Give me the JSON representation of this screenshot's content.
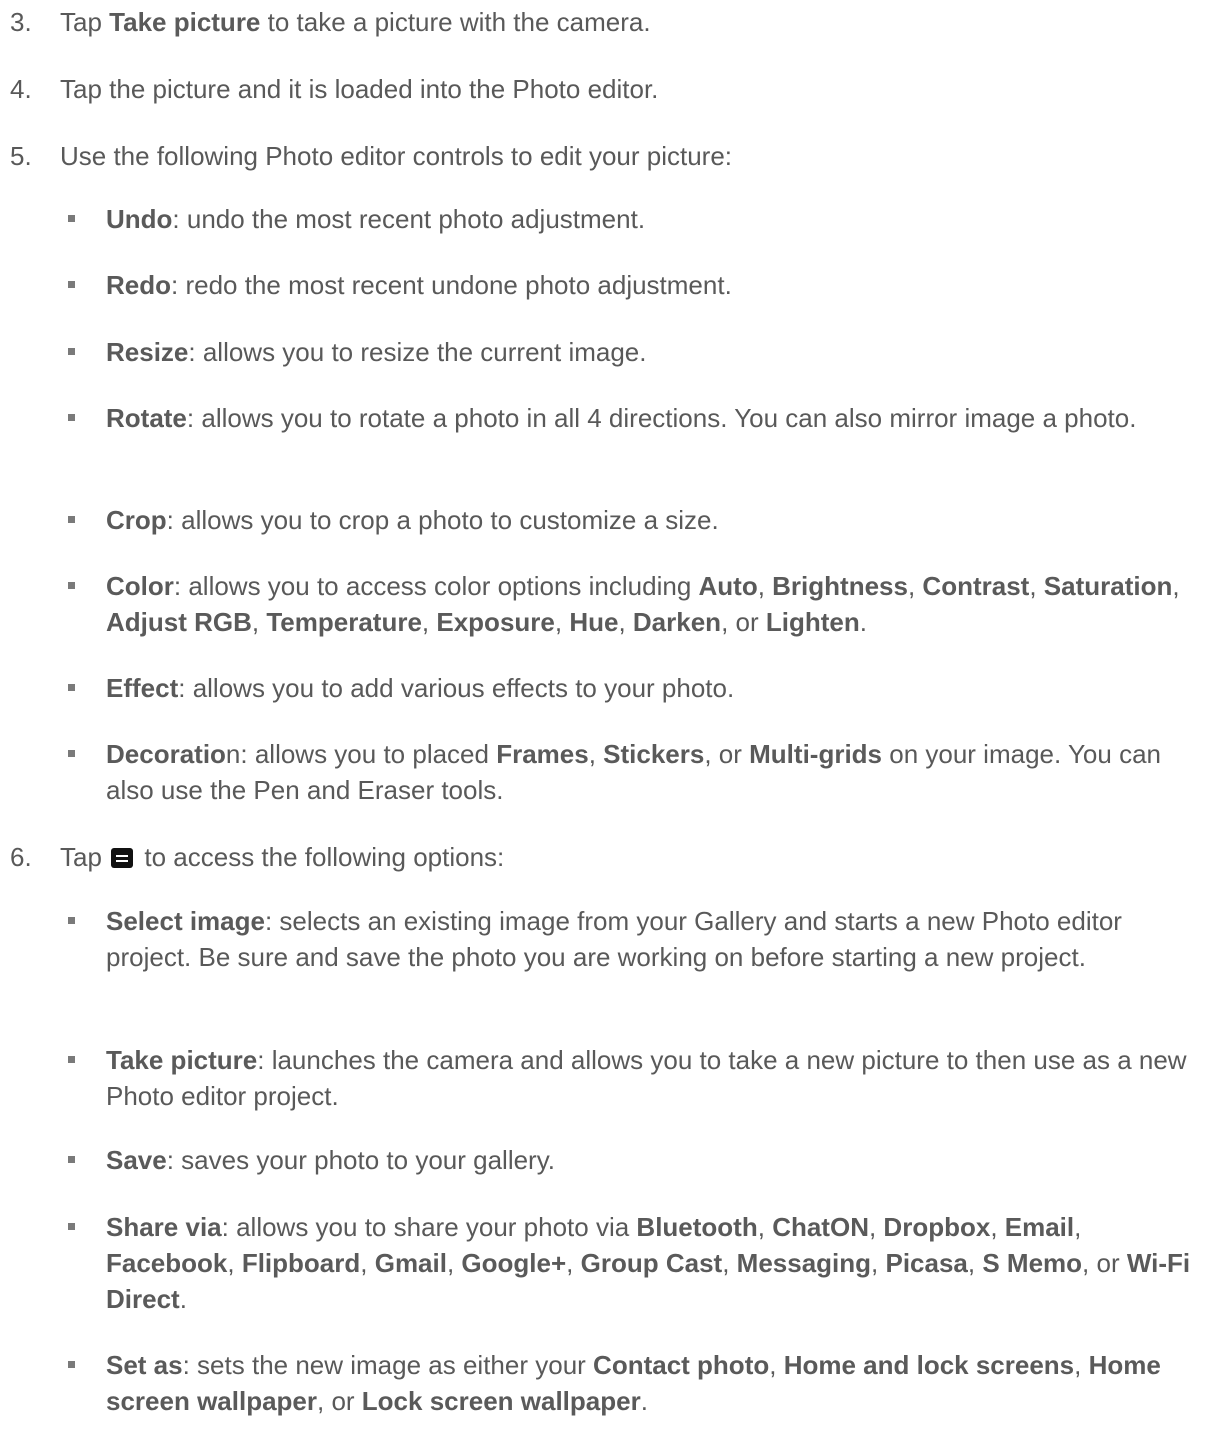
{
  "step3": {
    "num": "3.",
    "pre": "Tap ",
    "b1": "Take picture",
    "post": " to take a picture with the camera."
  },
  "step4": {
    "num": "4.",
    "text": "Tap the picture and it is loaded into the Photo editor."
  },
  "step5": {
    "num": "5.",
    "text": "Use the following Photo editor controls to edit your picture:"
  },
  "undo": {
    "b": "Undo",
    "text": ": undo the most recent photo adjustment."
  },
  "redo": {
    "b": "Redo",
    "text": ": redo the most recent undone photo adjustment."
  },
  "resize": {
    "b": "Resize",
    "text": ": allows you to resize the current image."
  },
  "rotate": {
    "b": "Rotate",
    "text": ": allows you to rotate a photo in all 4 directions. You can also mirror image a photo."
  },
  "crop": {
    "b": "Crop",
    "text": ": allows you to crop a photo to customize a size."
  },
  "color": {
    "b": "Color",
    "t1": ": allows you to access color options including ",
    "auto": "Auto",
    "brightness": "Brightness",
    "contrast": "Contrast",
    "saturation": "Saturation",
    "adjust_rgb": "Adjust RGB",
    "temperature": "Temperature",
    "exposure": "Exposure",
    "hue": "Hue",
    "darken": "Darken",
    "lighten": "Lighten",
    "comma": ", ",
    "or": ", or ",
    "end": "."
  },
  "effect": {
    "b": "Effect",
    "text": ": allows you to add various effects to your photo."
  },
  "decoration": {
    "b": "Decoratio",
    "n": "n",
    "t1": ": allows you to placed ",
    "frames": "Frames",
    "stickers": "Stickers",
    "multigrids": "Multi-grids",
    "t2": " on your image. You can also use the Pen and Eraser tools.",
    "comma": ", ",
    "or": ", or "
  },
  "step6": {
    "num": "6.",
    "pre": "Tap ",
    "icon": "menu-icon",
    "post": " to access the following options:"
  },
  "select_image": {
    "b": "Select image",
    "text": ": selects an existing image from your Gallery and starts a new Photo editor project. Be sure and save the photo you are working on before starting a new project."
  },
  "take_picture": {
    "b": "Take picture",
    "text": ": launches the camera and allows you to take a new picture to then use as a new Photo editor project."
  },
  "save": {
    "b": "Save",
    "text": ": saves your photo to your gallery."
  },
  "share": {
    "b": "Share via",
    "t1": ": allows you to share your photo via ",
    "bluetooth": "Bluetooth",
    "chaton": "ChatON",
    "dropbox": "Dropbox",
    "email": "Email",
    "facebook": "Facebook",
    "flipboard": "Flipboard",
    "gmail": "Gmail",
    "googleplus": "Google+",
    "groupcast": "Group Cast",
    "messaging": "Messaging",
    "picasa": "Picasa",
    "smemo": "S Memo",
    "wifidirect": "Wi-Fi Direct",
    "comma": ", ",
    "or": ", or ",
    "end": "."
  },
  "setas": {
    "b": "Set as",
    "t1": ": sets the new image as either your ",
    "contact": "Contact photo",
    "homelock": "Home and lock screens",
    "homewall": "Home screen wallpaper",
    "lockwall": "Lock screen wallpaper",
    "comma": ", ",
    "or": ", or ",
    "end": "."
  }
}
